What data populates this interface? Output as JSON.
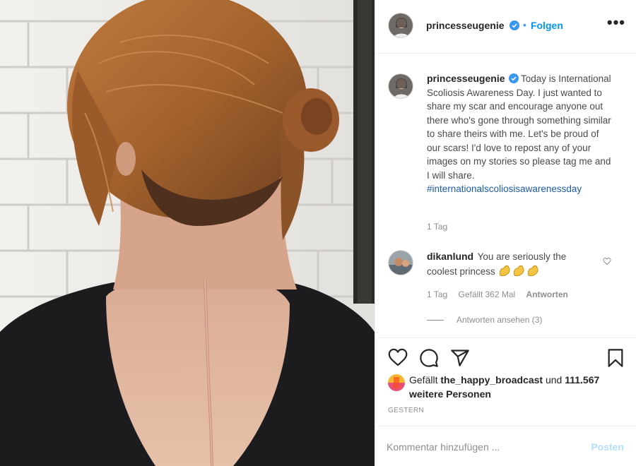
{
  "post": {
    "username": "princesseugenie",
    "follow_label": "Folgen",
    "dot": "•",
    "more_label": "•••",
    "caption": {
      "username": "princesseugenie",
      "text": "Today is International Scoliosis Awareness Day. I just wanted to share my scar and encourage anyone out there who's gone through something similar to share theirs with me. Let's be proud of our scars! I'd love to repost any of your images on my stories so please tag me and I will share.",
      "hashtag": "#internationalscoliosisawarenessday",
      "time": "1 Tag"
    },
    "comment": {
      "username": "dikanlund",
      "text": "You are seriously the coolest princess",
      "time": "1 Tag",
      "likes": "Gefällt 362 Mal",
      "reply_label": "Antworten",
      "view_replies": "Antworten ansehen (3)"
    },
    "likes": {
      "prefix": "Gefällt",
      "user": "the_happy_broadcast",
      "connector": "und",
      "count": "111.567 weitere Personen"
    },
    "date": "GESTERN",
    "comment_placeholder": "Kommentar hinzufügen ...",
    "post_label": "Posten"
  },
  "colors": {
    "accent": "#0095f6",
    "verified": "#3897f0",
    "hashtag": "#1c5aa6",
    "muted": "#8e8e8e",
    "post_disabled": "#b2dffc"
  },
  "icons": [
    "verified-badge-icon",
    "heart-icon",
    "comment-icon",
    "share-icon",
    "bookmark-icon",
    "small-heart-icon",
    "flexed-biceps-emoji"
  ]
}
